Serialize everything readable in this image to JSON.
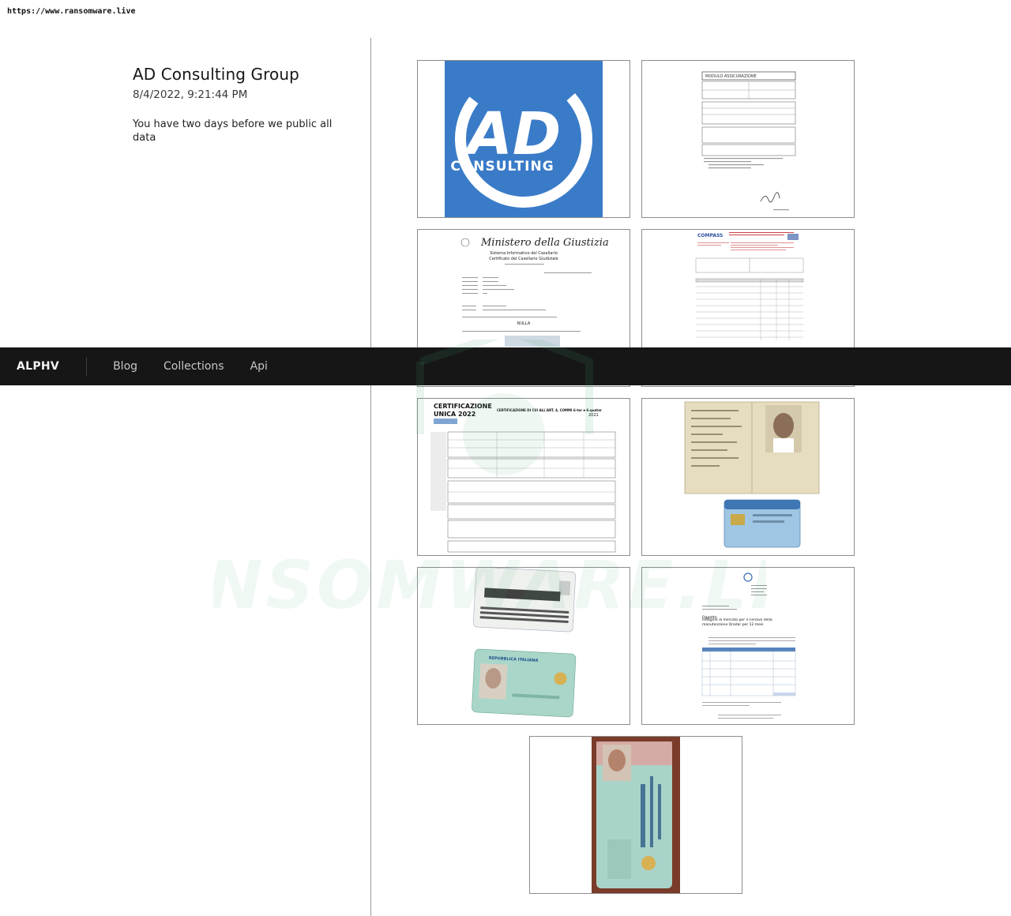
{
  "browser": {
    "url": "https://www.ransomware.live"
  },
  "navbar": {
    "brand": "ALPHV",
    "links": [
      "Blog",
      "Collections",
      "Api"
    ]
  },
  "post": {
    "title": "AD Consulting Group",
    "date": "8/4/2022, 9:21:44 PM",
    "message": "You have two days before we public all data"
  },
  "logo": {
    "line1": "AD",
    "line2": "CONSULTING",
    "color": "#3a7bc8"
  },
  "documents": {
    "doc2_header": "MODULO ASSICURAZIONE",
    "doc3_title": "Ministero della Giustizia",
    "doc3_sub1": "Sistema Informativo del Casellario",
    "doc3_sub2": "Certificato del Casellario Giudiziale",
    "doc3_nulla": "NULLA",
    "doc4_brand": "COMPASS",
    "doc5_title1": "CERTIFICAZIONE",
    "doc5_title2": "UNICA 2022",
    "doc5_right": "CERTIFICAZIONE DI CUI ALL'ART. 4, COMMI 6-ter e 6-quater",
    "doc5_year": "2021",
    "doc8_object": "Oggetto:",
    "doc8_subject": "Indagine di mercato per il rinnovo della manutenzione Qradar per 12 mesi",
    "card_republic": "REPUBBLICA ITALIANA"
  },
  "watermark": {
    "text": "RANSOMWARE.LIVE"
  }
}
